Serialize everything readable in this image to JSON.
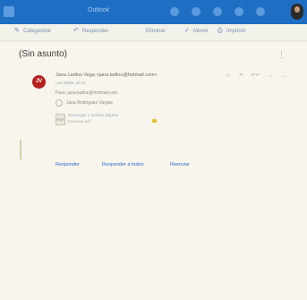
{
  "topbar": {
    "app_title": "Outlook"
  },
  "commandbar": {
    "items": [
      {
        "label": "Categorizar",
        "icon": "pencil-icon"
      },
      {
        "label": "Responder",
        "icon": "reply-icon"
      },
      {
        "label": "Eliminar",
        "icon": "trash-icon"
      },
      {
        "label": "Mover",
        "icon": "check-icon"
      },
      {
        "label": "Imprimir",
        "icon": "print-icon"
      }
    ]
  },
  "message": {
    "subject": "(Sin asunto)",
    "avatar_initials": "JV",
    "sender": "Jana Ladino Vega <jana.ladino@hotmail.com>",
    "date": "Lun 06/05, 10:17",
    "para": "Para: jana.ladino@hotmail.com",
    "contact": "Jana Rodriguez Vargas",
    "attachment_line1": "Descargar 1 archivo adjunto",
    "attachment_line2": "Escaneo.pdf"
  },
  "actions": {
    "reply": "Responder",
    "reply_all": "Responder a todos",
    "forward": "Reenviar"
  },
  "colors": {
    "accent": "#1e6fc4",
    "avatar": "#b41f1f",
    "link": "#2e6ccd"
  }
}
